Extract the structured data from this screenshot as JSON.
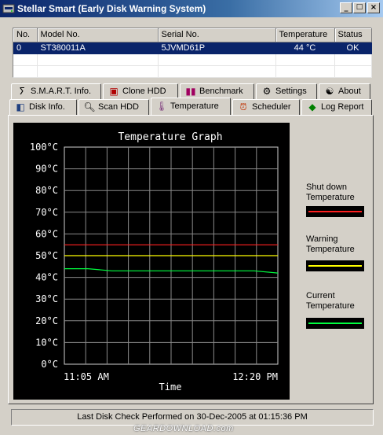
{
  "window": {
    "title": "Stellar Smart (Early Disk Warning System)",
    "minimize": "_",
    "maximize": "□",
    "close": "×"
  },
  "disk_table": {
    "headers": [
      "No.",
      "Model No.",
      "Serial No.",
      "Temperature",
      "Status"
    ],
    "rows": [
      {
        "no": "0",
        "model": "ST380011A",
        "serial": "5JVMD61P",
        "temperature": "44 °C",
        "status": "OK"
      }
    ]
  },
  "tabs_row1": [
    {
      "label": "S.M.A.R.T. Info.",
      "icon": "smart-icon"
    },
    {
      "label": "Clone HDD",
      "icon": "clone-icon"
    },
    {
      "label": "Benchmark",
      "icon": "benchmark-icon"
    },
    {
      "label": "Settings",
      "icon": "settings-icon"
    },
    {
      "label": "About",
      "icon": "about-icon"
    }
  ],
  "tabs_row2": [
    {
      "label": "Disk Info.",
      "icon": "disk-icon"
    },
    {
      "label": "Scan HDD",
      "icon": "scan-icon"
    },
    {
      "label": "Temperature",
      "icon": "thermometer-icon",
      "active": true
    },
    {
      "label": "Scheduler",
      "icon": "clock-icon"
    },
    {
      "label": "Log Report",
      "icon": "log-icon"
    }
  ],
  "chart_data": {
    "type": "line",
    "title": "Temperature Graph",
    "xlabel": "Time",
    "ylabel": "",
    "x_ticks": [
      "11:05 AM",
      "12:20 PM"
    ],
    "y_ticks": [
      "100°C",
      "90°C",
      "80°C",
      "70°C",
      "60°C",
      "50°C",
      "40°C",
      "30°C",
      "20°C",
      "10°C",
      "0°C"
    ],
    "ylim": [
      0,
      100
    ],
    "grid": true,
    "series": [
      {
        "name": "Shut down Temperature",
        "color": "#ff2020",
        "values": [
          55,
          55
        ]
      },
      {
        "name": "Warning Temperature",
        "color": "#ffff00",
        "values": [
          50,
          50
        ]
      },
      {
        "name": "Current Temperature",
        "color": "#00ff40",
        "values": [
          44,
          44,
          43,
          43,
          43,
          43,
          43,
          43,
          43,
          42
        ]
      }
    ]
  },
  "legend": {
    "shutdown": "Shut down\nTemperature",
    "warning": "Warning\nTemperature",
    "current": "Current\nTemperature"
  },
  "status_bar": "Last Disk Check Performed on 30-Dec-2005 at 01:15:36 PM",
  "watermark": "GEARDOWNLOAD.com"
}
